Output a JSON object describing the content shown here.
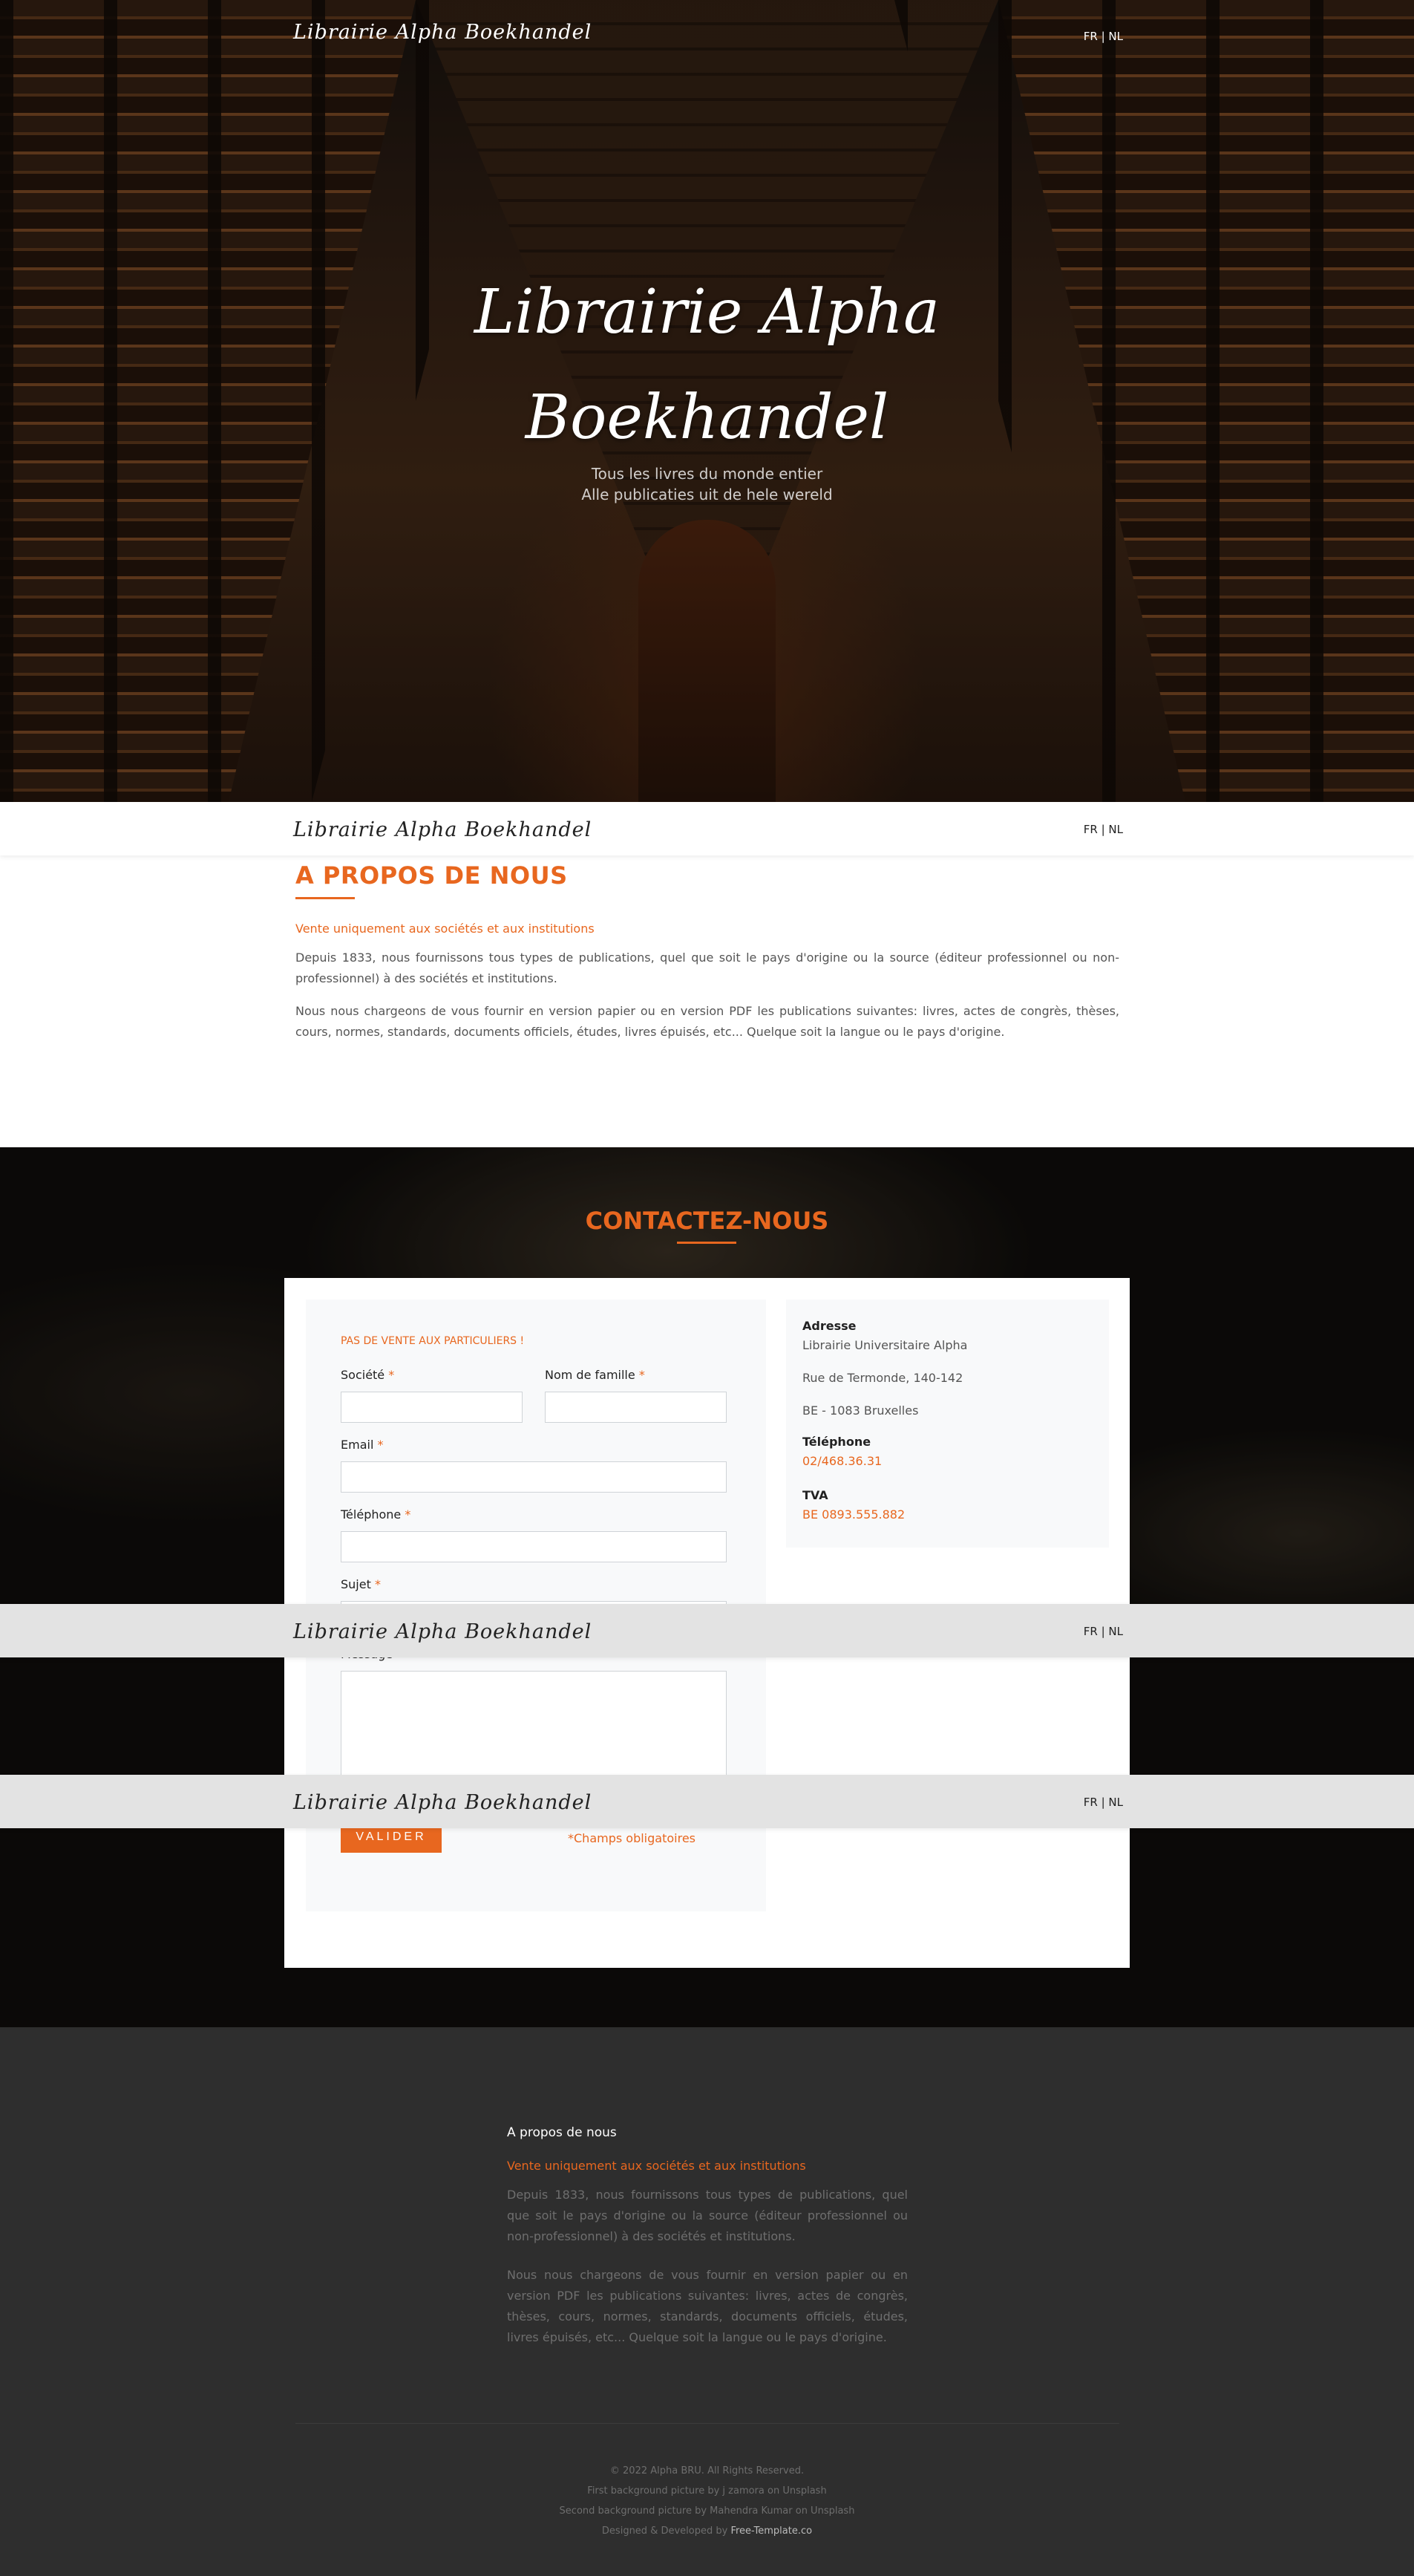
{
  "brand": "Librairie Alpha Boekhandel",
  "lang": {
    "fr": "FR",
    "sep": " | ",
    "nl": "NL"
  },
  "hero": {
    "title_line1": "Librairie Alpha",
    "title_line2": "Boekhandel",
    "subtitle_line1": "Tous les livres du monde entier",
    "subtitle_line2": "Alle publicaties uit de hele wereld"
  },
  "about": {
    "heading": "A PROPOS DE NOUS",
    "lead": "Vente uniquement aux sociétés et aux institutions",
    "p1": "Depuis 1833, nous fournissons tous types de publications, quel que soit le pays d'origine ou la source (éditeur professionnel ou non-professionnel) à des sociétés et institutions.",
    "p2": "Nous nous chargeons de vous fournir en version papier ou en version PDF les publications suivantes: livres, actes de congrès, thèses, cours, normes, standards, documents officiels, études, livres épuisés, etc... Quelque soit la langue ou le pays d'origine."
  },
  "contact": {
    "heading": "CONTACTEZ-NOUS",
    "form": {
      "note": "PAS DE VENTE AUX PARTICULIERS !",
      "societe": "Société",
      "nom": "Nom de famille",
      "email": "Email",
      "telephone": "Téléphone",
      "sujet": "Sujet",
      "message": "Message",
      "required_mark": "*",
      "submit": "VALIDER",
      "required_note": "*Champs obligatoires"
    },
    "info": {
      "address_label": "Adresse",
      "address_line1": "Librairie Universitaire Alpha",
      "address_line2": "Rue de Termonde, 140-142",
      "address_line3": "BE - 1083 Bruxelles",
      "phone_label": "Téléphone",
      "phone": "02/468.36.31",
      "tva_label": "TVA",
      "tva": "BE 0893.555.882"
    }
  },
  "footer": {
    "title": "A propos de nous",
    "lead": "Vente uniquement aux sociétés et aux institutions",
    "p1": "Depuis 1833, nous fournissons tous types de publications, quel que soit le pays d'origine ou la source (éditeur professionnel ou non-professionnel) à des sociétés et institutions.",
    "p2": "Nous nous chargeons de vous fournir en version papier ou en version PDF les publications suivantes: livres, actes de congrès, thèses, cours, normes, standards, documents officiels, études, livres épuisés, etc... Quelque soit la langue ou le pays d'origine.",
    "copyright": "© 2022 Alpha BRU. All Rights Reserved.",
    "credit1": "First background picture by j zamora on Unsplash",
    "credit2": "Second background picture by Mahendra Kumar on Unsplash",
    "credit3_prefix": "Designed & Developed by ",
    "credit3_link": "Free-Template.co"
  },
  "colors": {
    "accent": "#e8671f",
    "footer_bg": "#2e2e2e"
  }
}
